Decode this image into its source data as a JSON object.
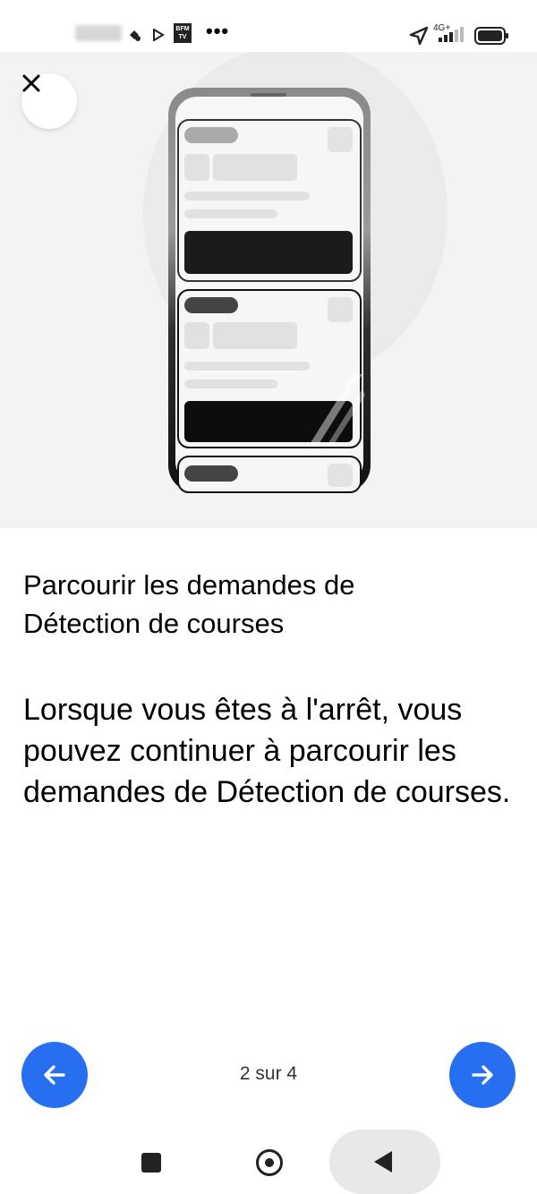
{
  "status_bar": {
    "dots": "•••",
    "network": "4G+",
    "bfm_label": "BFM TV"
  },
  "close_label": "Fermer",
  "title": " Parcourir les demandes de\nDétection de courses",
  "body": "Lorsque vous êtes à l'arrêt, vous pouvez continuer à parcourir les demandes de Détection de courses.",
  "pager": {
    "current": 2,
    "total": 4,
    "label": "2 sur 4"
  },
  "colors": {
    "accent": "#276ef1",
    "hero_bg": "#f3f3f3"
  },
  "icons": {
    "close": "close-icon",
    "prev": "arrow-left-icon",
    "next": "arrow-right-icon",
    "location": "location-arrow-icon",
    "signal": "signal-icon",
    "battery": "battery-icon"
  }
}
